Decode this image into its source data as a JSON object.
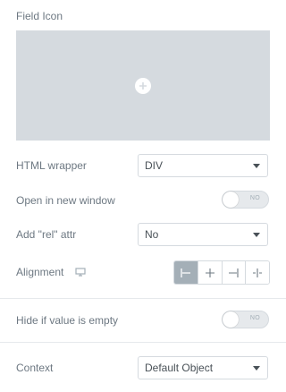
{
  "field_icon": {
    "label": "Field Icon"
  },
  "html_wrapper": {
    "label": "HTML wrapper",
    "value": "DIV"
  },
  "open_new_window": {
    "label": "Open in new window",
    "toggle_text": "NO"
  },
  "add_rel_attr": {
    "label": "Add \"rel\" attr",
    "value": "No"
  },
  "alignment": {
    "label": "Alignment",
    "options": [
      "align-start-icon",
      "align-center-icon",
      "align-end-icon",
      "align-justify-icon"
    ],
    "active_index": 0
  },
  "hide_if_empty": {
    "label": "Hide if value is empty",
    "toggle_text": "NO"
  },
  "context": {
    "label": "Context",
    "value": "Default Object"
  },
  "colors": {
    "accent_active": "#a4afb7",
    "placeholder_bg": "#d5dadf"
  }
}
